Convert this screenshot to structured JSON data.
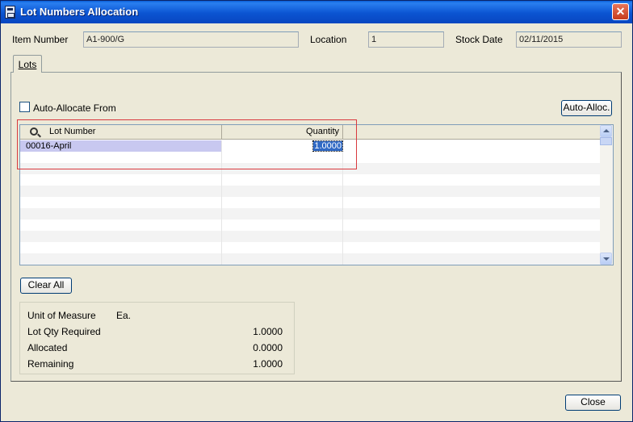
{
  "window": {
    "title": "Lot Numbers Allocation",
    "close_glyph": "✕"
  },
  "header": {
    "item_number_label": "Item Number",
    "item_number_value": "A1-900/G",
    "location_label": "Location",
    "location_value": "1",
    "stock_date_label": "Stock Date",
    "stock_date_value": "02/11/2015"
  },
  "tabs": [
    {
      "label": "Lots"
    }
  ],
  "auto_allocate": {
    "label": "Auto-Allocate From",
    "checked": false
  },
  "buttons": {
    "auto_alloc": "Auto-Alloc.",
    "clear_all": "Clear All",
    "close": "Close"
  },
  "grid": {
    "columns": [
      "Lot Number",
      "Quantity"
    ],
    "rows": [
      {
        "lot_number": "00016-April",
        "quantity": "1.0000",
        "selected": true
      }
    ],
    "empty_row_count": 10
  },
  "summary": {
    "unit_of_measure_label": "Unit of Measure",
    "unit_of_measure_value": "Ea.",
    "lot_qty_required_label": "Lot Qty Required",
    "lot_qty_required_value": "1.0000",
    "allocated_label": "Allocated",
    "allocated_value": "0.0000",
    "remaining_label": "Remaining",
    "remaining_value": "1.0000"
  },
  "colors": {
    "titlebar": "#0b54d2",
    "selection": "#316ac5",
    "highlight_box": "#d9393e",
    "window_bg": "#ece9d8"
  },
  "icons": {
    "window": "save-disk-icon",
    "grid_header": "search-icon",
    "close": "close-icon"
  }
}
